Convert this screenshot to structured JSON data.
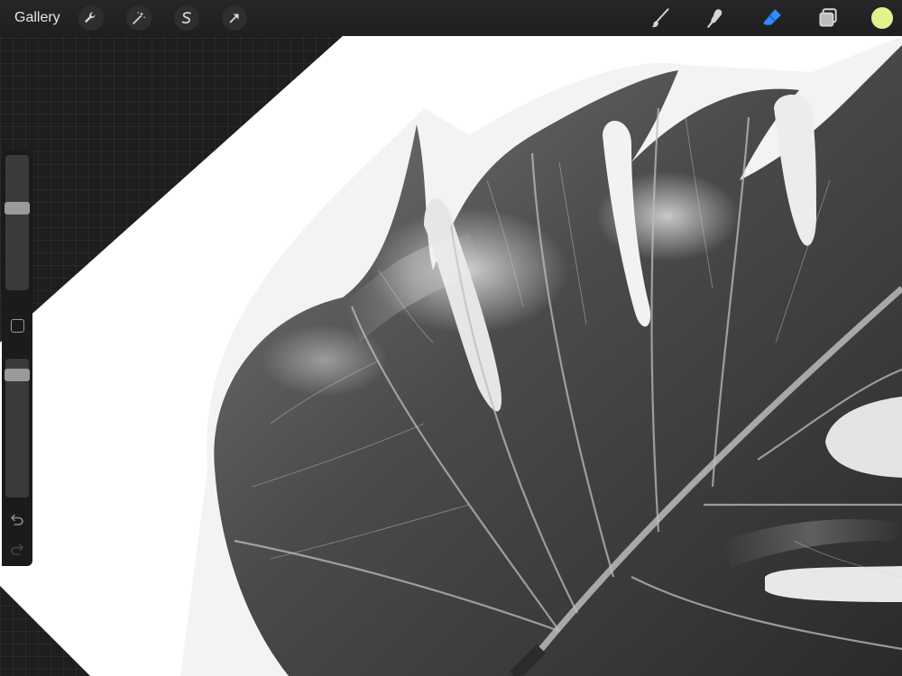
{
  "topbar": {
    "gallery_label": "Gallery",
    "left_tools": [
      {
        "icon": "wrench-icon",
        "name": "actions"
      },
      {
        "icon": "magic-wand-icon",
        "name": "adjustments"
      },
      {
        "icon": "selection-s-icon",
        "name": "selection"
      },
      {
        "icon": "arrow-cursor-icon",
        "name": "transform"
      }
    ],
    "right_tools": [
      {
        "icon": "brush-icon",
        "name": "paint",
        "active": false
      },
      {
        "icon": "smudge-icon",
        "name": "smudge",
        "active": false
      },
      {
        "icon": "eraser-icon",
        "name": "erase",
        "active": true
      },
      {
        "icon": "layers-icon",
        "name": "layers",
        "active": false
      }
    ],
    "current_color": "#e3f28a"
  },
  "sidebar": {
    "brush_size_level": 0.62,
    "opacity_level": 0.92,
    "icons": [
      "modify-square-icon",
      "undo-icon",
      "redo-icon"
    ]
  },
  "canvas": {
    "subject": "monstera-leaf-grayscale-photo"
  },
  "colors": {
    "accent": "#2f8bff",
    "canvas_bg": "#ffffff"
  }
}
